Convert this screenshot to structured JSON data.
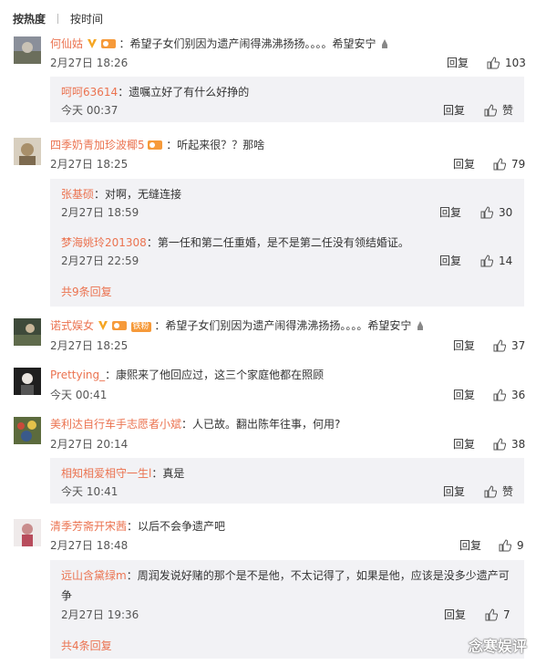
{
  "sort": {
    "hot": "按热度",
    "time": "按时间"
  },
  "reply_label": "回复",
  "comments": [
    {
      "user": "何仙姑",
      "text": "：希望子女们别因为遗产闹得沸沸扬扬。。。。希望安宁",
      "time": "2月27日 18:26",
      "likes": "103"
    },
    {
      "user": "四季奶青加珍波椰5",
      "text": "：听起来很？？那啥",
      "time": "2月27日 18:25",
      "likes": "79"
    },
    {
      "user": "诺式娱女",
      "badge": "铁粉",
      "text": "：希望子女们别因为遗产闹得沸沸扬扬。。。。希望安宁",
      "time": "2月27日 18:25",
      "likes": "37"
    },
    {
      "user": "Prettying_",
      "text": "：康熙来了他回应过，这三个家庭他都在照顾",
      "time": "今天 00:41",
      "likes": "36"
    },
    {
      "user": "美利达自行车手志愿者小斌",
      "text": "：人已故。翻出陈年往事，何用?",
      "time": "2月27日 20:14",
      "likes": "38"
    },
    {
      "user": "清季芳斋开宋茜",
      "text": "：以后不会争遗产吧",
      "time": "2月27日 18:48",
      "likes": "9"
    }
  ],
  "replies": [
    {
      "user": "呵呵63614",
      "text": "：遗嘱立好了有什么好挣的",
      "time": "今天 00:37",
      "likes": "赞"
    },
    {
      "user": "张基硕",
      "text": "：对啊，无缝连接",
      "time": "2月27日 18:59",
      "likes": "30"
    },
    {
      "user": "梦海姚玲201308",
      "text": "：第一任和第二任重婚，是不是第二任没有领结婚证。",
      "time": "2月27日 22:59",
      "likes": "14"
    },
    {
      "user": "相知相爱相守一生l",
      "text": "：真是",
      "time": "今天 10:41",
      "likes": "赞"
    },
    {
      "user": "远山含黛绿m",
      "text_line1": "：周润发说好赌的那个是不是他，不太记得了，如果是他，应该是没多少遗产可",
      "text_line2": "争",
      "time": "2月27日 19:36",
      "likes": "7"
    }
  ],
  "more": [
    "共9条回复",
    "共4条回复"
  ],
  "watermark": "念寒娱评",
  "colors": {
    "username": "#eb7350",
    "sub_bg": "#f2f2f5",
    "accent": "#f69a3a"
  }
}
